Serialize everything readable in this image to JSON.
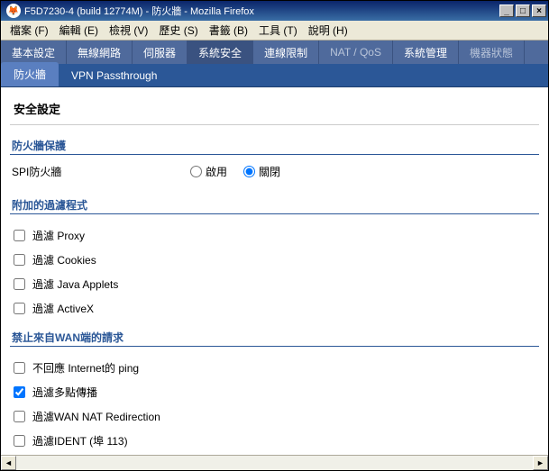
{
  "window": {
    "title": "F5D7230-4 (build 12774M) - 防火牆 - Mozilla Firefox",
    "min": "_",
    "max": "□",
    "close": "×"
  },
  "menu": {
    "file": "檔案 (F)",
    "edit": "編輯 (E)",
    "view": "檢視 (V)",
    "history": "歷史 (S)",
    "bookmarks": "書籤 (B)",
    "tools": "工具 (T)",
    "help": "說明 (H)"
  },
  "tabs1": {
    "basic": "基本設定",
    "wireless": "無線網路",
    "server": "伺服器",
    "security": "系統安全",
    "conn": "連線限制",
    "natqos": "NAT / QoS",
    "admin": "系統管理",
    "status": "機器狀態"
  },
  "tabs2": {
    "firewall": "防火牆",
    "vpn": "VPN Passthrough"
  },
  "page": {
    "title": "安全設定",
    "sec_firewall": "防火牆保護",
    "spi_label": "SPI防火牆",
    "enable": "啟用",
    "disable": "關閉",
    "sec_filters": "附加的過濾程式",
    "filter_proxy": "過濾 Proxy",
    "filter_cookies": "過濾 Cookies",
    "filter_java": "過濾 Java Applets",
    "filter_activex": "過濾 ActiveX",
    "sec_wan": "禁止來自WAN端的請求",
    "wan_ping": "不回應 Internet的 ping",
    "wan_multicast": "過濾多點傳播",
    "wan_nat": "過濾WAN NAT Redirection",
    "wan_ident": "過濾IDENT (埠 113)"
  },
  "state": {
    "spi": "disable",
    "filter_proxy": false,
    "filter_cookies": false,
    "filter_java": false,
    "filter_activex": false,
    "wan_ping": false,
    "wan_multicast": true,
    "wan_nat": false,
    "wan_ident": false
  }
}
